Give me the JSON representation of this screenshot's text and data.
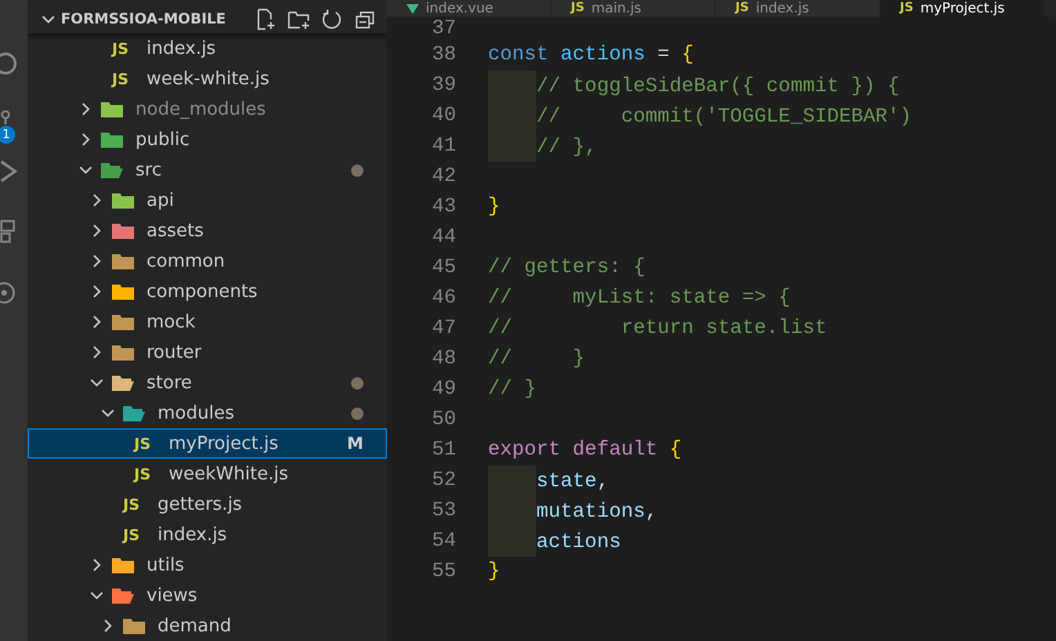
{
  "activity_bar": {
    "badge": "1"
  },
  "explorer": {
    "title": "FORMSSIOA-MOBILE",
    "expanded": true,
    "tree": [
      {
        "children": [
          {
            "kind": "file",
            "label": "index.js",
            "icon": "JS",
            "selected": false
          },
          {
            "kind": "file",
            "label": "week-white.js",
            "icon": "JS",
            "selected": false
          }
        ]
      },
      {
        "kind": "folder",
        "label": "node_modules",
        "expanded": false,
        "ignored": true,
        "color": "#8bc34a",
        "modified": false,
        "selected": false
      },
      {
        "kind": "folder",
        "label": "public",
        "expanded": false,
        "color": "#4caf50",
        "modified": false,
        "selected": false
      },
      {
        "kind": "folder",
        "label": "src",
        "expanded": true,
        "color": "#43a047",
        "modified": true,
        "selected": false,
        "children": [
          {
            "kind": "folder",
            "label": "api",
            "expanded": false,
            "color": "#8bc34a",
            "modified": false,
            "selected": false
          },
          {
            "kind": "folder",
            "label": "assets",
            "expanded": false,
            "color": "#e57373",
            "modified": false,
            "selected": false
          },
          {
            "kind": "folder",
            "label": "common",
            "expanded": false,
            "color": "#c09553",
            "modified": false,
            "selected": false
          },
          {
            "kind": "folder",
            "label": "components",
            "expanded": false,
            "color": "#ffb300",
            "modified": false,
            "selected": false
          },
          {
            "kind": "folder",
            "label": "mock",
            "expanded": false,
            "color": "#c09553",
            "modified": false,
            "selected": false
          },
          {
            "kind": "folder",
            "label": "router",
            "expanded": false,
            "color": "#c09553",
            "modified": false,
            "selected": false
          },
          {
            "kind": "folder",
            "label": "store",
            "expanded": true,
            "color": "#dcb67a",
            "modified": true,
            "selected": false,
            "children": [
              {
                "kind": "folder",
                "label": "modules",
                "expanded": true,
                "color": "#26a69a",
                "modified": true,
                "selected": false,
                "children": [
                  {
                    "kind": "file",
                    "label": "myProject.js",
                    "icon": "JS",
                    "badge": "M",
                    "selected": true
                  },
                  {
                    "kind": "file",
                    "label": "weekWhite.js",
                    "icon": "JS",
                    "selected": false
                  }
                ]
              },
              {
                "kind": "file",
                "label": "getters.js",
                "icon": "JS",
                "selected": false
              },
              {
                "kind": "file",
                "label": "index.js",
                "icon": "JS",
                "selected": false
              }
            ]
          },
          {
            "kind": "folder",
            "label": "utils",
            "expanded": false,
            "color": "#f9a825",
            "modified": false,
            "selected": false
          },
          {
            "kind": "folder",
            "label": "views",
            "expanded": true,
            "color": "#ff7043",
            "modified": false,
            "selected": false,
            "children": [
              {
                "kind": "folder",
                "label": "demand",
                "expanded": false,
                "color": "#c09553",
                "modified": false,
                "selected": false
              }
            ]
          }
        ]
      }
    ]
  },
  "tabs": [
    {
      "label": "index.vue",
      "kind": "vue",
      "selected": false
    },
    {
      "label": "main.js",
      "kind": "js",
      "icon": "JS",
      "selected": false
    },
    {
      "label": "index.js",
      "kind": "js",
      "icon": "JS",
      "selected": false
    },
    {
      "label": "myProject.js",
      "kind": "js",
      "icon": "JS",
      "selected": true
    }
  ],
  "editor": {
    "lines": [
      {
        "number": "37",
        "indented": false
      },
      {
        "number": "38",
        "indented": false,
        "tokens": [
          {
            "kind": "keyword",
            "text": "const "
          },
          {
            "kind": "variable",
            "text": "actions"
          },
          {
            "kind": "plain",
            "text": " = "
          },
          {
            "kind": "brace",
            "text": "{"
          }
        ]
      },
      {
        "number": "39",
        "indented": true,
        "tokens": [
          {
            "kind": "comment",
            "text": "// toggleSideBar({ commit }) {"
          }
        ]
      },
      {
        "number": "40",
        "indented": true,
        "tokens": [
          {
            "kind": "comment",
            "text": "//     commit('TOGGLE_SIDEBAR')"
          }
        ]
      },
      {
        "number": "41",
        "indented": true,
        "tokens": [
          {
            "kind": "comment",
            "text": "// },"
          }
        ]
      },
      {
        "number": "42",
        "indented": false
      },
      {
        "number": "43",
        "indented": false,
        "tokens": [
          {
            "kind": "brace",
            "text": "}"
          }
        ]
      },
      {
        "number": "44",
        "indented": false
      },
      {
        "number": "45",
        "indented": false,
        "tokens": [
          {
            "kind": "comment",
            "text": "// getters: {"
          }
        ]
      },
      {
        "number": "46",
        "indented": false,
        "tokens": [
          {
            "kind": "comment",
            "text": "//     myList: state => {"
          }
        ]
      },
      {
        "number": "47",
        "indented": false,
        "tokens": [
          {
            "kind": "comment",
            "text": "//         return state.list"
          }
        ]
      },
      {
        "number": "48",
        "indented": false,
        "tokens": [
          {
            "kind": "comment",
            "text": "//     }"
          }
        ]
      },
      {
        "number": "49",
        "indented": false,
        "tokens": [
          {
            "kind": "comment",
            "text": "// }"
          }
        ]
      },
      {
        "number": "50",
        "indented": false
      },
      {
        "number": "51",
        "indented": false,
        "tokens": [
          {
            "kind": "control",
            "text": "export default "
          },
          {
            "kind": "brace",
            "text": "{"
          }
        ]
      },
      {
        "number": "52",
        "indented": true,
        "tokens": [
          {
            "kind": "property",
            "text": "state"
          },
          {
            "kind": "plain",
            "text": ","
          }
        ]
      },
      {
        "number": "53",
        "indented": true,
        "tokens": [
          {
            "kind": "property",
            "text": "mutations"
          },
          {
            "kind": "plain",
            "text": ","
          }
        ]
      },
      {
        "number": "54",
        "indented": true,
        "tokens": [
          {
            "kind": "property",
            "text": "actions"
          }
        ]
      },
      {
        "number": "55",
        "indented": false,
        "tokens": [
          {
            "kind": "brace",
            "text": "}"
          }
        ]
      }
    ]
  }
}
